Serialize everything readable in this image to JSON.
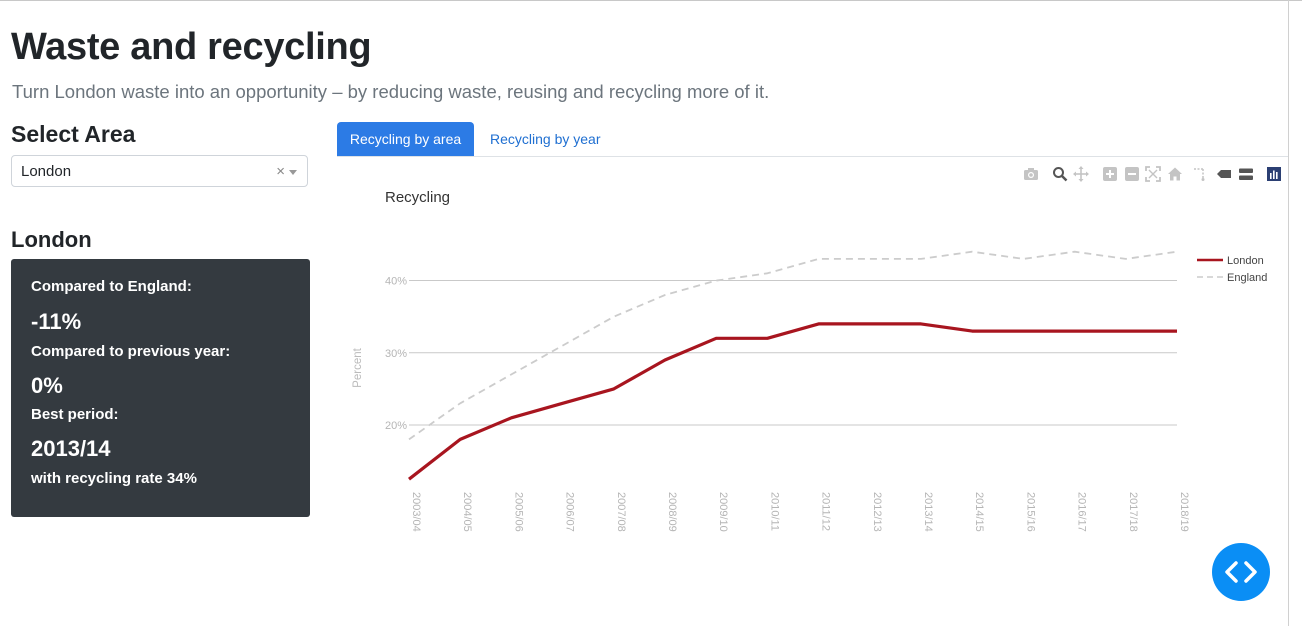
{
  "header": {
    "title": "Waste and recycling",
    "subtitle": "Turn London waste into an opportunity – by reducing waste, reusing and recycling more of it."
  },
  "sidebar": {
    "select_label": "Select Area",
    "select_value": "London",
    "clear_glyph": "×",
    "area_heading": "London",
    "card": {
      "compared_england_label": "Compared to England:",
      "compared_england_value": "-11%",
      "compared_prev_label": "Compared to previous year:",
      "compared_prev_value": "0%",
      "best_period_label": "Best period:",
      "best_period_value": "2013/14",
      "best_rate_text": "with recycling rate 34%"
    }
  },
  "tabs": [
    {
      "label": "Recycling by area",
      "active": true
    },
    {
      "label": "Recycling by year",
      "active": false
    }
  ],
  "modebar_icons": [
    "camera-icon",
    "zoom-icon",
    "pan-icon",
    "zoom-in-icon",
    "zoom-out-icon",
    "autoscale-icon",
    "home-icon",
    "spike-lines-icon",
    "hover-closest-icon",
    "hover-compare-icon",
    "plotly-logo-icon"
  ],
  "colors": {
    "accent": "#2c7be5",
    "card_bg": "#343a40",
    "london": "#a8151f",
    "england": "#cccccc",
    "fab": "#0a8ef5"
  },
  "chart_data": {
    "type": "line",
    "title": "Recycling",
    "xlabel": "",
    "ylabel": "Percent",
    "categories": [
      "2003/04",
      "2004/05",
      "2005/06",
      "2006/07",
      "2007/08",
      "2008/09",
      "2009/10",
      "2010/11",
      "2011/12",
      "2012/13",
      "2013/14",
      "2014/15",
      "2015/16",
      "2016/17",
      "2017/18",
      "2018/19"
    ],
    "yticks": [
      "20%",
      "30%",
      "40%"
    ],
    "ylim": [
      11,
      47
    ],
    "grid": true,
    "legend_position": "top-right",
    "series": [
      {
        "name": "London",
        "style": "solid",
        "values": [
          12.5,
          18,
          21,
          23,
          25,
          29,
          32,
          32,
          34,
          34,
          34,
          33,
          33,
          33,
          33,
          33
        ]
      },
      {
        "name": "England",
        "style": "dashed",
        "values": [
          18,
          23,
          27,
          31,
          35,
          38,
          40,
          41,
          43,
          43,
          43,
          44,
          43,
          44,
          43,
          44
        ]
      }
    ]
  },
  "fab": {
    "icon": "code-icon"
  }
}
